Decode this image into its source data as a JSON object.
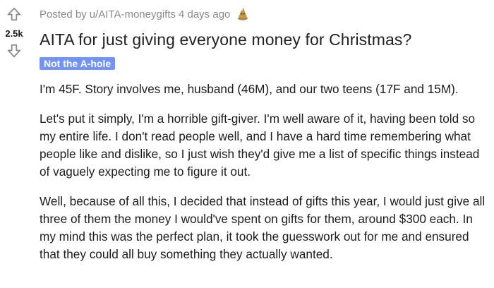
{
  "vote": {
    "score": "2.5k",
    "upvote_icon": "upvote-arrow-icon",
    "downvote_icon": "downvote-arrow-icon"
  },
  "post": {
    "posted_by_prefix": "Posted by",
    "author": "u/AITA-moneygifts",
    "time": "4 days ago",
    "award_icon": "award-icon",
    "title": "AITA for just giving everyone money for Christmas?",
    "flair": "Not the A-hole",
    "paragraphs": [
      "I'm 45F. Story involves me, husband (46M), and our two teens (17F and 15M).",
      "Let's put it simply, I'm a horrible gift-giver. I'm well aware of it, having been told so my entire life. I don't read people well, and I have a hard time remembering what people like and dislike, so I just wish they'd give me a list of specific things instead of vaguely expecting me to figure it out.",
      "Well, because of all this, I decided that instead of gifts this year, I would just give all three of them the money I would've spent on gifts for them, around $300 each. In my mind this was the perfect plan, it took the guesswork out for me and ensured that they could all buy something they actually wanted."
    ]
  },
  "colors": {
    "flair_bg": "#7193ff",
    "meta_text": "#878a8c",
    "body_text": "#1c1c1c"
  }
}
